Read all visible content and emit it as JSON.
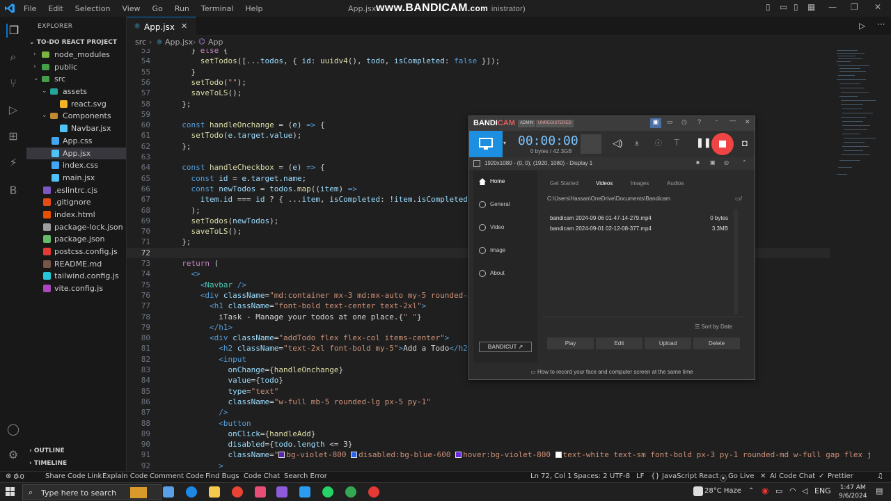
{
  "titlebar": {
    "menus": [
      "File",
      "Edit",
      "Selection",
      "View",
      "Go",
      "Run",
      "Terminal",
      "Help"
    ],
    "window_title_left": "App.jsx",
    "watermark_main": "www.BANDICAM",
    "watermark_suffix": ".com",
    "window_title_right": "inistrator)"
  },
  "explorer": {
    "header": "EXPLORER",
    "project": "TO-DO REACT PROJECT",
    "items": [
      {
        "name": "node_modules",
        "depth": 1,
        "kind": "folder-closed",
        "color": "#7cb342"
      },
      {
        "name": "public",
        "depth": 1,
        "kind": "folder-closed",
        "color": "#43a047"
      },
      {
        "name": "src",
        "depth": 1,
        "kind": "folder-open",
        "color": "#43a047"
      },
      {
        "name": "assets",
        "depth": 2,
        "kind": "folder-open",
        "color": "#26a69a"
      },
      {
        "name": "react.svg",
        "depth": 3,
        "kind": "file",
        "color": "#f0b429"
      },
      {
        "name": "Components",
        "depth": 2,
        "kind": "folder-open",
        "color": "#c08b30"
      },
      {
        "name": "Navbar.jsx",
        "depth": 3,
        "kind": "file",
        "color": "#4fc3f7"
      },
      {
        "name": "App.css",
        "depth": 2,
        "kind": "file",
        "color": "#42a5f5"
      },
      {
        "name": "App.jsx",
        "depth": 2,
        "kind": "file",
        "color": "#4fc3f7",
        "selected": true
      },
      {
        "name": "index.css",
        "depth": 2,
        "kind": "file",
        "color": "#42a5f5"
      },
      {
        "name": "main.jsx",
        "depth": 2,
        "kind": "file",
        "color": "#4fc3f7"
      },
      {
        "name": ".eslintrc.cjs",
        "depth": 1,
        "kind": "file",
        "color": "#7e57c2"
      },
      {
        "name": ".gitignore",
        "depth": 1,
        "kind": "file",
        "color": "#e64a19"
      },
      {
        "name": "index.html",
        "depth": 1,
        "kind": "file",
        "color": "#e65100"
      },
      {
        "name": "package-lock.json",
        "depth": 1,
        "kind": "file",
        "color": "#9e9e9e"
      },
      {
        "name": "package.json",
        "depth": 1,
        "kind": "file",
        "color": "#66bb6a"
      },
      {
        "name": "postcss.config.js",
        "depth": 1,
        "kind": "file",
        "color": "#e53935"
      },
      {
        "name": "README.md",
        "depth": 1,
        "kind": "file",
        "color": "#795548"
      },
      {
        "name": "tailwind.config.js",
        "depth": 1,
        "kind": "file",
        "color": "#26c6da"
      },
      {
        "name": "vite.config.js",
        "depth": 1,
        "kind": "file",
        "color": "#ab47bc"
      }
    ],
    "outline": "OUTLINE",
    "timeline": "TIMELINE"
  },
  "editor": {
    "tab_label": "App.jsx",
    "breadcrumb": [
      "src",
      "App.jsx",
      "App"
    ],
    "current_line": 72,
    "lines": [
      {
        "n": "53",
        "html": "    <span class='p'>} </span><span class='k'>else</span><span class='p'> {</span>"
      },
      {
        "n": "54",
        "html": "      <span class='fn'>setTodos</span><span class='p'>([...</span><span class='v'>todos</span><span class='p'>, { </span><span class='v'>id</span><span class='p'>: </span><span class='fn'>uuidv4</span><span class='p'>(), </span><span class='v'>todo</span><span class='p'>, </span><span class='v'>isCompleted</span><span class='p'>: </span><span class='kw'>false</span><span class='p'> }]);</span>"
      },
      {
        "n": "55",
        "html": "    <span class='p'>}</span>"
      },
      {
        "n": "56",
        "html": "    <span class='fn'>setTodo</span><span class='p'>(</span><span class='s'>\"\"</span><span class='p'>);</span>"
      },
      {
        "n": "57",
        "html": "    <span class='fn'>saveToLS</span><span class='p'>();</span>"
      },
      {
        "n": "58",
        "html": "  <span class='p'>};</span>"
      },
      {
        "n": "59",
        "html": ""
      },
      {
        "n": "60",
        "html": "  <span class='kw'>const</span> <span class='fn'>handleOnchange</span><span class='p'> = (</span><span class='v'>e</span><span class='p'>) </span><span class='kw'>=&gt;</span><span class='p'> {</span>"
      },
      {
        "n": "61",
        "html": "    <span class='fn'>setTodo</span><span class='p'>(</span><span class='v'>e</span><span class='p'>.</span><span class='v'>target</span><span class='p'>.</span><span class='v'>value</span><span class='p'>);</span>"
      },
      {
        "n": "62",
        "html": "  <span class='p'>};</span>"
      },
      {
        "n": "63",
        "html": ""
      },
      {
        "n": "64",
        "html": "  <span class='kw'>const</span> <span class='fn'>handleCheckbox</span><span class='p'> = (</span><span class='v'>e</span><span class='p'>) </span><span class='kw'>=&gt;</span><span class='p'> {</span>"
      },
      {
        "n": "65",
        "html": "    <span class='kw'>const</span> <span class='v'>id</span><span class='p'> = </span><span class='v'>e</span><span class='p'>.</span><span class='v'>target</span><span class='p'>.</span><span class='v'>name</span><span class='p'>;</span>"
      },
      {
        "n": "66",
        "html": "    <span class='kw'>const</span> <span class='v'>newTodos</span><span class='p'> = </span><span class='v'>todos</span><span class='p'>.</span><span class='fn'>map</span><span class='p'>((</span><span class='v'>item</span><span class='p'>) </span><span class='kw'>=&gt;</span>"
      },
      {
        "n": "67",
        "html": "      <span class='v'>item</span><span class='p'>.</span><span class='v'>id</span><span class='p'> === </span><span class='v'>id</span><span class='p'> ? { ...</span><span class='v'>item</span><span class='p'>, </span><span class='v'>isCompleted</span><span class='p'>: !</span><span class='v'>item</span><span class='p'>.</span><span class='v'>isCompleted</span><span class='p'> } : </span><span class='v'>it</span>"
      },
      {
        "n": "68",
        "html": "    <span class='p'>);</span>"
      },
      {
        "n": "69",
        "html": "    <span class='fn'>setTodos</span><span class='p'>(</span><span class='v'>newTodos</span><span class='p'>);</span>"
      },
      {
        "n": "70",
        "html": "    <span class='fn'>saveToLS</span><span class='p'>();</span>"
      },
      {
        "n": "71",
        "html": "  <span class='p'>};</span>"
      },
      {
        "n": "72",
        "html": ""
      },
      {
        "n": "73",
        "html": "  <span class='k'>return</span><span class='p'> (</span>"
      },
      {
        "n": "74",
        "html": "    <span class='tg'>&lt;&gt;</span>"
      },
      {
        "n": "75",
        "html": "      <span class='tg'>&lt;</span><span class='t'>Navbar</span><span class='tg'> /&gt;</span>"
      },
      {
        "n": "76",
        "html": "      <span class='tg'>&lt;div</span> <span class='at'>className</span><span class='p'>=</span><span class='s'>\"md:container mx-3 md:mx-auto my-5 rounded-xl <span class='sw' style='background:#fff'></span>b</span>"
      },
      {
        "n": "77",
        "html": "        <span class='tg'>&lt;h1</span> <span class='at'>className</span><span class='p'>=</span><span class='s'>\"font-bold text-center text-2xl\"</span><span class='tg'>&gt;</span>"
      },
      {
        "n": "78",
        "html": "          <span class='p'>iTask - Manage your todos at one place.{</span><span class='s'>\" \"</span><span class='p'>}</span>"
      },
      {
        "n": "79",
        "html": "        <span class='tg'>&lt;/h1&gt;</span>"
      },
      {
        "n": "80",
        "html": "        <span class='tg'>&lt;div</span> <span class='at'>className</span><span class='p'>=</span><span class='s'>\"addTodo flex flex-col items-center\"</span><span class='tg'>&gt;</span>"
      },
      {
        "n": "81",
        "html": "          <span class='tg'>&lt;h2</span> <span class='at'>className</span><span class='p'>=</span><span class='s'>\"text-2xl font-bold my-5\"</span><span class='tg'>&gt;</span><span class='p'>Add a Todo</span><span class='tg'>&lt;/h2&gt;</span>"
      },
      {
        "n": "82",
        "html": "          <span class='tg'>&lt;input</span>"
      },
      {
        "n": "83",
        "html": "            <span class='at'>onChange</span><span class='p'>={</span><span class='fn'>handleOnchange</span><span class='p'>}</span>"
      },
      {
        "n": "84",
        "html": "            <span class='at'>value</span><span class='p'>={</span><span class='v'>todo</span><span class='p'>}</span>"
      },
      {
        "n": "85",
        "html": "            <span class='at'>type</span><span class='p'>=</span><span class='s'>\"text\"</span>"
      },
      {
        "n": "86",
        "html": "            <span class='at'>className</span><span class='p'>=</span><span class='s'>\"w-full mb-5 rounded-lg px-5 py-1\"</span>"
      },
      {
        "n": "87",
        "html": "          <span class='tg'>/&gt;</span>"
      },
      {
        "n": "88",
        "html": "          <span class='tg'>&lt;button</span>"
      },
      {
        "n": "89",
        "html": "            <span class='at'>onClick</span><span class='p'>={</span><span class='fn'>handleAdd</span><span class='p'>}</span>"
      },
      {
        "n": "90",
        "html": "            <span class='at'>disabled</span><span class='p'>={</span><span class='v'>todo</span><span class='p'>.</span><span class='v'>length</span><span class='p'> &lt;= 3}</span>"
      },
      {
        "n": "91",
        "html": "            <span class='at'>className</span><span class='p'>=</span><span class='s'>\"<span class='sw' style='background:#5b21b6'></span>bg-violet-800 <span class='sw' style='background:#2563eb'></span>disabled:bg-blue-600 <span class='sw' style='background:#6d28d9'></span>hover:bg-violet-800 <span class='sw' style='background:#fff'></span>text-white text-sm font-bold px-3 py-1 rounded-md w-full gap flex j</span>"
      },
      {
        "n": "92",
        "html": "          <span class='tg'>&gt;</span>"
      }
    ]
  },
  "statusbar": {
    "errors": "0",
    "warnings": "0",
    "left_items": [
      "Share Code Link",
      "Explain Code",
      "Comment Code",
      "Find Bugs",
      "Code Chat",
      "Search Error"
    ],
    "position": "Ln 72, Col 1",
    "spaces": "Spaces: 2",
    "encoding": "UTF-8",
    "eol": "LF",
    "language": "JavaScript React",
    "golive": "Go Live",
    "aichat": "AI Code Chat",
    "prettier": "Prettier"
  },
  "taskbar": {
    "search_placeholder": "Type here to search",
    "weather": "28°C  Haze",
    "time": "1:47 AM",
    "date": "9/6/2024"
  },
  "bandicam": {
    "logo_a": "BANDI",
    "logo_b": "CAM",
    "badge_admin": "ADMIN",
    "badge_unreg": "UNREGISTERED",
    "timer": "00:00:00",
    "size": "0 bytes / 42.3GB",
    "display_info": "1920x1080 - (0, 0), (1920, 1080) - Display 1",
    "nav": [
      "Home",
      "General",
      "Video",
      "Image",
      "About"
    ],
    "bandicut": "BANDICUT ↗",
    "tabs": [
      "Get Started",
      "Videos",
      "Images",
      "Audios"
    ],
    "path": "C:\\Users\\Hassan\\OneDrive\\Documents\\Bandicam",
    "files": [
      {
        "name": "bandicam 2024-09-06 01-47-14-279.mp4",
        "size": "0 bytes"
      },
      {
        "name": "bandicam 2024-09-01 02-12-08-377.mp4",
        "size": "3.3MB"
      }
    ],
    "sort": "Sort by Date",
    "buttons": [
      "Play",
      "Edit",
      "Upload",
      "Delete"
    ],
    "footer": "How to record your face and computer screen at the same time"
  }
}
